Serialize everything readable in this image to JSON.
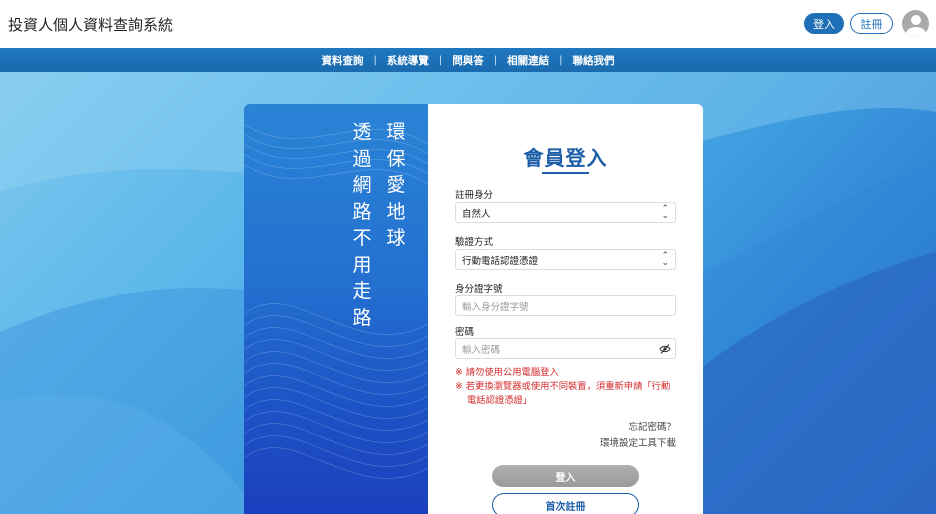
{
  "header": {
    "site_title": "投資人個人資料查詢系統",
    "login_label": "登入",
    "register_label": "註冊",
    "avatar_icon": "user-avatar-icon"
  },
  "nav": {
    "items": [
      "資料查詢",
      "系統導覽",
      "問與答",
      "相關連結",
      "聯絡我們"
    ],
    "separator": "|"
  },
  "slogan": {
    "column_right": [
      "環",
      "保",
      "愛",
      "地",
      "球"
    ],
    "column_left": [
      "透",
      "過",
      "網",
      "路",
      "不",
      "用",
      "走",
      "路"
    ]
  },
  "form": {
    "title": "會員登入",
    "identity_label": "註冊身分",
    "identity_value": "自然人",
    "method_label": "驗證方式",
    "method_value": "行動電話認證憑證",
    "id_label": "身分證字號",
    "id_placeholder": "輸入身分證字號",
    "password_label": "密碼",
    "password_placeholder": "輸入密碼",
    "note_1": "※ 請勿使用公用電腦登入",
    "note_2_line1": "※ 若更換瀏覽器或使用不同裝置，須重新申請「行動",
    "note_2_line2": "電話認證憑證」",
    "forgot_password": "忘記密碼？",
    "env_tool": "環境設定工具下載",
    "login_button": "登入",
    "first_register_button": "首次註冊"
  },
  "colors": {
    "brand_blue": "#1e6fb5",
    "title_blue": "#1c5ea8",
    "warning_red": "#d32a2a",
    "disabled_gray": "#a6a6a6"
  }
}
